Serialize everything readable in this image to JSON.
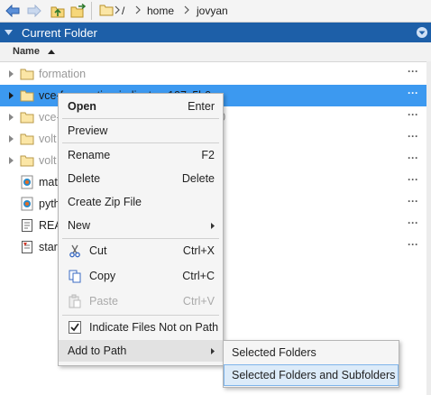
{
  "toolbar": {
    "back_icon": "back-arrow-icon",
    "forward_icon": "forward-arrow-icon",
    "up_icon": "up-folder-icon",
    "browse_icon": "browse-folder-icon",
    "path_icon": "folder-icon",
    "breadcrumb": [
      "/",
      "home",
      "jovyan"
    ]
  },
  "panel": {
    "title": "Current Folder",
    "column_header": "Name",
    "accent_color": "#1d5fa8",
    "selected_color": "#3c99f0"
  },
  "files": [
    {
      "name": "formation",
      "type": "folder",
      "expandable": true,
      "dimmed": true
    },
    {
      "name": "vce-forecasting-indicator_197c5b0a",
      "type": "folder",
      "expandable": true,
      "dimmed": false,
      "selected": true
    },
    {
      "name": "vce-performance-indicator_eb9395c0",
      "type": "folder",
      "expandable": true,
      "dimmed": true
    },
    {
      "name": "volt",
      "type": "folder",
      "expandable": true,
      "dimmed": true
    },
    {
      "name": "volt",
      "type": "folder",
      "expandable": true,
      "dimmed": true
    },
    {
      "name": "mat",
      "type": "file",
      "dimmed": false
    },
    {
      "name": "pyth",
      "type": "file",
      "dimmed": false
    },
    {
      "name": "REA",
      "type": "file",
      "dimmed": false
    },
    {
      "name": "star",
      "type": "file",
      "dimmed": false
    }
  ],
  "context_menu": {
    "open": {
      "label": "Open",
      "shortcut": "Enter"
    },
    "preview": {
      "label": "Preview"
    },
    "rename": {
      "label": "Rename",
      "shortcut": "F2"
    },
    "delete": {
      "label": "Delete",
      "shortcut": "Delete"
    },
    "create_zip": {
      "label": "Create Zip File"
    },
    "new": {
      "label": "New"
    },
    "cut": {
      "label": "Cut",
      "shortcut": "Ctrl+X"
    },
    "copy": {
      "label": "Copy",
      "shortcut": "Ctrl+C"
    },
    "paste": {
      "label": "Paste",
      "shortcut": "Ctrl+V",
      "disabled": true
    },
    "indicate": {
      "label": "Indicate Files Not on Path",
      "checked": true
    },
    "add_to_path": {
      "label": "Add to Path"
    }
  },
  "submenu": {
    "selected_folders": "Selected Folders",
    "selected_folders_and_subfolders": "Selected Folders and Subfolders"
  }
}
